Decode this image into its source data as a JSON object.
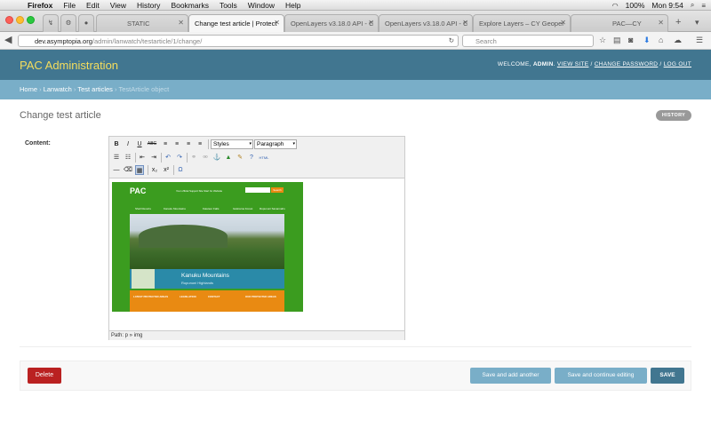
{
  "menubar": {
    "apple": "",
    "items": [
      "Firefox",
      "File",
      "Edit",
      "View",
      "History",
      "Bookmarks",
      "Tools",
      "Window",
      "Help"
    ],
    "battery": "100%",
    "clock": "Mon 9:54"
  },
  "tabs": [
    {
      "label": "STATIC"
    },
    {
      "label": "Change test article | Protect"
    },
    {
      "label": "OpenLayers v3.18.0 API - C"
    },
    {
      "label": "OpenLayers v3.18.0 API - C"
    },
    {
      "label": "Explore Layers – CY Geoper"
    },
    {
      "label": "PAC—CY"
    }
  ],
  "navbar": {
    "url_host": "dev.asymptopia.org",
    "url_path": "/admin/lanwatch/testarticle/1/change/",
    "search_placeholder": "Search"
  },
  "header": {
    "site_title": "PAC Administration",
    "welcome": "Welcome, ",
    "user": "admin",
    "view_site": "View site",
    "change_password": "Change password",
    "log_out": "Log out",
    "sep": " / "
  },
  "breadcrumbs": {
    "home": "Home",
    "app": "Lanwatch",
    "model": "Test articles",
    "current": "TestArticle object",
    "sep": " › "
  },
  "page": {
    "title": "Change test article",
    "history": "HISTORY",
    "content_label": "Content:"
  },
  "editor": {
    "bold": "B",
    "italic": "I",
    "underline": "U",
    "strike": "ABC",
    "styles": "Styles",
    "format": "Paragraph",
    "status_path": "Path: p » img",
    "html_label": "HTML",
    "sup": "x²",
    "sub": "x₂",
    "omega": "Ω"
  },
  "embedded_image": {
    "logo": "PAC",
    "tagline": "Your official Support Site Start for Website",
    "search_btn": "Search",
    "menu": [
      "Shell Resorts",
      "Kanuku Mountains",
      "Kaieteur Falls",
      "Iwokrama Forest",
      "Rupununi Savannahs"
    ],
    "title": "Kanuku Mountains",
    "subtitle": "Rupununi Highlands",
    "orange_blocks": [
      "LATEST PROTECTED AREAS",
      "LEGISLATION",
      "CONTACT",
      "OUR PROTECTED AREAS"
    ]
  },
  "submit": {
    "delete": "Delete",
    "save_add": "Save and add another",
    "save_continue": "Save and continue editing",
    "save": "SAVE"
  }
}
